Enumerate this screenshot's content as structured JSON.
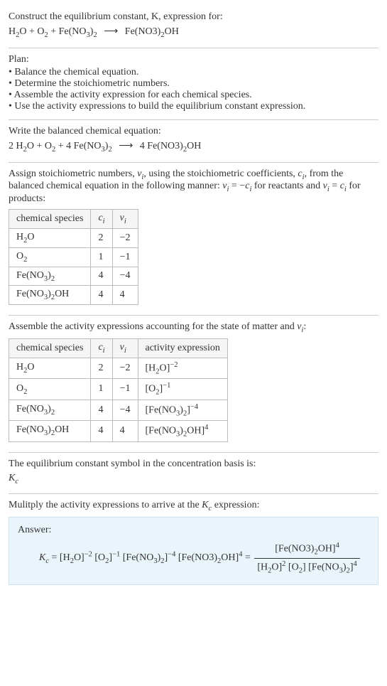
{
  "intro": {
    "line1": "Construct the equilibrium constant, K, expression for:",
    "equation_html": "H<span class='sub'>2</span>O + O<span class='sub'>2</span> + Fe(NO<span class='sub'>3</span>)<span class='sub'>2</span> <span class='arrow'>⟶</span> Fe(NO3)<span class='sub'>2</span>OH"
  },
  "plan": {
    "heading": "Plan:",
    "items": [
      "Balance the chemical equation.",
      "Determine the stoichiometric numbers.",
      "Assemble the activity expression for each chemical species.",
      "Use the activity expressions to build the equilibrium constant expression."
    ]
  },
  "balanced": {
    "heading": "Write the balanced chemical equation:",
    "equation_html": "2 H<span class='sub'>2</span>O + O<span class='sub'>2</span> + 4 Fe(NO<span class='sub'>3</span>)<span class='sub'>2</span> <span class='arrow'>⟶</span> 4 Fe(NO3)<span class='sub'>2</span>OH"
  },
  "stoich": {
    "heading_html": "Assign stoichiometric numbers, <span class='italic'>ν<span class='sub'>i</span></span>, using the stoichiometric coefficients, <span class='italic'>c<span class='sub'>i</span></span>, from the balanced chemical equation in the following manner: <span class='italic'>ν<span class='sub'>i</span></span> = −<span class='italic'>c<span class='sub'>i</span></span> for reactants and <span class='italic'>ν<span class='sub'>i</span></span> = <span class='italic'>c<span class='sub'>i</span></span> for products:",
    "headers": [
      "chemical species",
      "c_i",
      "ν_i"
    ],
    "headers_html": [
      "chemical species",
      "<span class='italic'>c<span class='sub'>i</span></span>",
      "<span class='italic'>ν<span class='sub'>i</span></span>"
    ],
    "rows": [
      {
        "species_html": "H<span class='sub'>2</span>O",
        "c": "2",
        "nu": "−2"
      },
      {
        "species_html": "O<span class='sub'>2</span>",
        "c": "1",
        "nu": "−1"
      },
      {
        "species_html": "Fe(NO<span class='sub'>3</span>)<span class='sub'>2</span>",
        "c": "4",
        "nu": "−4"
      },
      {
        "species_html": "Fe(NO<span class='sub'>3</span>)<span class='sub'>2</span>OH",
        "c": "4",
        "nu": "4"
      }
    ]
  },
  "activity": {
    "heading_html": "Assemble the activity expressions accounting for the state of matter and <span class='italic'>ν<span class='sub'>i</span></span>:",
    "headers_html": [
      "chemical species",
      "<span class='italic'>c<span class='sub'>i</span></span>",
      "<span class='italic'>ν<span class='sub'>i</span></span>",
      "activity expression"
    ],
    "rows": [
      {
        "species_html": "H<span class='sub'>2</span>O",
        "c": "2",
        "nu": "−2",
        "act_html": "[H<span class='sub'>2</span>O]<span class='sup'>−2</span>"
      },
      {
        "species_html": "O<span class='sub'>2</span>",
        "c": "1",
        "nu": "−1",
        "act_html": "[O<span class='sub'>2</span>]<span class='sup'>−1</span>"
      },
      {
        "species_html": "Fe(NO<span class='sub'>3</span>)<span class='sub'>2</span>",
        "c": "4",
        "nu": "−4",
        "act_html": "[Fe(NO<span class='sub'>3</span>)<span class='sub'>2</span>]<span class='sup'>−4</span>"
      },
      {
        "species_html": "Fe(NO<span class='sub'>3</span>)<span class='sub'>2</span>OH",
        "c": "4",
        "nu": "4",
        "act_html": "[Fe(NO<span class='sub'>3</span>)<span class='sub'>2</span>OH]<span class='sup'>4</span>"
      }
    ]
  },
  "symbol": {
    "heading": "The equilibrium constant symbol in the concentration basis is:",
    "symbol_html": "<span class='italic'>K<span class='sub'>c</span></span>"
  },
  "multiply": {
    "heading_html": "Mulitply the activity expressions to arrive at the <span class='italic'>K<span class='sub'>c</span></span> expression:"
  },
  "answer": {
    "label": "Answer:",
    "lhs_html": "<span class='italic'>K<span class='sub'>c</span></span> = [H<span class='sub'>2</span>O]<span class='sup'>−2</span> [O<span class='sub'>2</span>]<span class='sup'>−1</span> [Fe(NO<span class='sub'>3</span>)<span class='sub'>2</span>]<span class='sup'>−4</span> [Fe(NO3)<span class='sub'>2</span>OH]<span class='sup'>4</span> = ",
    "num_html": "[Fe(NO3)<span class='sub'>2</span>OH]<span class='sup'>4</span>",
    "den_html": "[H<span class='sub'>2</span>O]<span class='sup'>2</span> [O<span class='sub'>2</span>] [Fe(NO<span class='sub'>3</span>)<span class='sub'>2</span>]<span class='sup'>4</span>"
  },
  "chart_data": {
    "type": "table",
    "tables": [
      {
        "title": "Stoichiometric numbers",
        "columns": [
          "chemical species",
          "c_i",
          "ν_i"
        ],
        "rows": [
          [
            "H2O",
            2,
            -2
          ],
          [
            "O2",
            1,
            -1
          ],
          [
            "Fe(NO3)2",
            4,
            -4
          ],
          [
            "Fe(NO3)2OH",
            4,
            4
          ]
        ]
      },
      {
        "title": "Activity expressions",
        "columns": [
          "chemical species",
          "c_i",
          "ν_i",
          "activity expression"
        ],
        "rows": [
          [
            "H2O",
            2,
            -2,
            "[H2O]^-2"
          ],
          [
            "O2",
            1,
            -1,
            "[O2]^-1"
          ],
          [
            "Fe(NO3)2",
            4,
            -4,
            "[Fe(NO3)2]^-4"
          ],
          [
            "Fe(NO3)2OH",
            4,
            4,
            "[Fe(NO3)2OH]^4"
          ]
        ]
      }
    ]
  }
}
